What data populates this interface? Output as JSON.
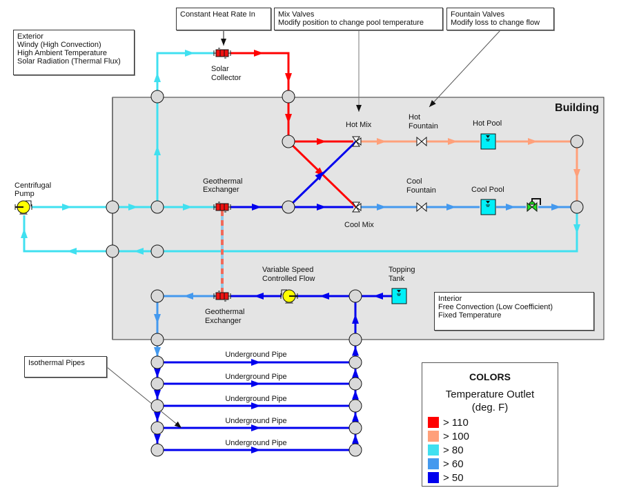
{
  "colors": {
    "gt110": "#ff0000",
    "gt100": "#ffa07a",
    "gt80": "#40e0f0",
    "gt60": "#4499ee",
    "gt50": "#0000ee",
    "node_fill": "#d9d9d9",
    "building_fill": "#e4e4e4",
    "tank_fill": "#00f0f8",
    "pump_fill": "#ffff00",
    "exchanger_fill": "#ee1111",
    "control_valve_fill": "#22dd22"
  },
  "building": {
    "title": "Building"
  },
  "notes": {
    "exterior": [
      "Exterior",
      "Windy (High Convection)",
      "High Ambient Temperature",
      "Solar Radiation (Thermal Flux)"
    ],
    "heat_rate": [
      "Constant Heat Rate In"
    ],
    "mix_valves": [
      "Mix Valves",
      "Modify position to change pool temperature"
    ],
    "fountain_valves": [
      "Fountain Valves",
      "Modify loss to change flow"
    ],
    "interior": [
      "Interior",
      "Free Convection (Low Coefficient)",
      "Fixed Temperature"
    ],
    "isothermal": [
      "Isothermal Pipes"
    ]
  },
  "components": {
    "solar_collector": [
      "Solar",
      "Collector"
    ],
    "centrifugal_pump": [
      "Centrifugal",
      "Pump"
    ],
    "geothermal_exchanger_top": [
      "Geothermal",
      "Exchanger"
    ],
    "geothermal_exchanger_bottom": [
      "Geothermal",
      "Exchanger"
    ],
    "hot_mix": "Hot Mix",
    "cool_mix": "Cool Mix",
    "hot_fountain": [
      "Hot",
      "Fountain"
    ],
    "cool_fountain": [
      "Cool",
      "Fountain"
    ],
    "hot_pool": "Hot Pool",
    "cool_pool": "Cool Pool",
    "variable_speed_pump": [
      "Variable Speed",
      "Controlled Flow"
    ],
    "topping_tank": [
      "Topping",
      "Tank"
    ]
  },
  "underground_pipes": [
    "Underground Pipe",
    "Underground Pipe",
    "Underground Pipe",
    "Underground Pipe",
    "Underground Pipe"
  ],
  "legend": {
    "title": "COLORS",
    "subtitle_line1": "Temperature Outlet",
    "subtitle_line2": "(deg. F)",
    "items": [
      {
        "label": "> 110",
        "color": "#ff0000"
      },
      {
        "label": "> 100",
        "color": "#ffa07a"
      },
      {
        "label": "> 80",
        "color": "#40e0f0"
      },
      {
        "label": "> 60",
        "color": "#4499ee"
      },
      {
        "label": "> 50",
        "color": "#0000ee"
      }
    ]
  }
}
